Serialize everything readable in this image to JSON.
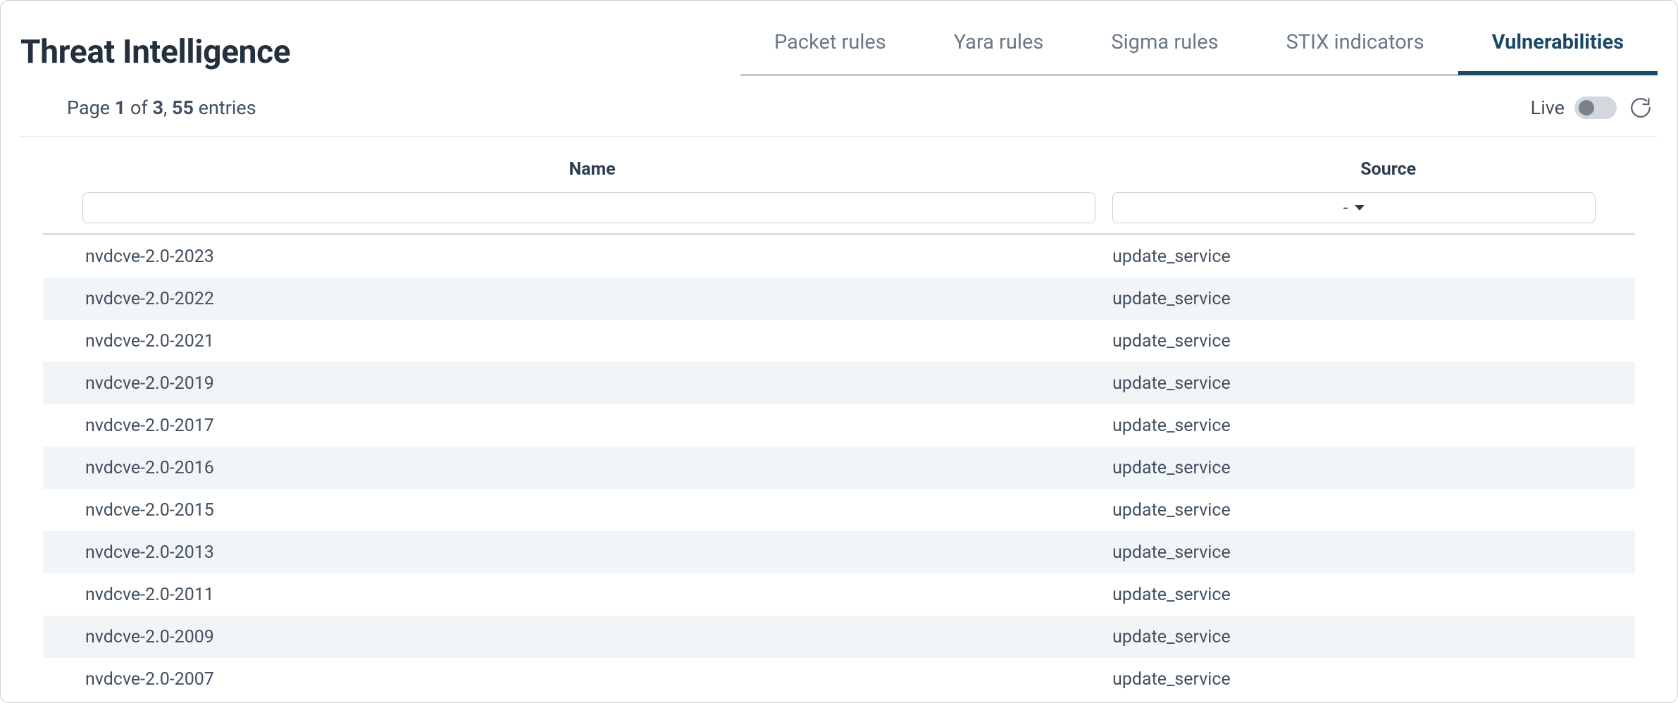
{
  "header": {
    "title": "Threat Intelligence"
  },
  "tabs": [
    {
      "label": "Packet rules",
      "active": false
    },
    {
      "label": "Yara rules",
      "active": false
    },
    {
      "label": "Sigma rules",
      "active": false
    },
    {
      "label": "STIX indicators",
      "active": false
    },
    {
      "label": "Vulnerabilities",
      "active": true
    }
  ],
  "pagination": {
    "prefix": "Page ",
    "current": "1",
    "of_word": " of ",
    "total_pages": "3",
    "comma": ", ",
    "total_entries": "55",
    "suffix": " entries"
  },
  "live": {
    "label": "Live",
    "enabled": false
  },
  "table": {
    "columns": {
      "name": "Name",
      "source": "Source"
    },
    "filters": {
      "name_value": "",
      "source_selected": "-"
    },
    "rows": [
      {
        "name": "nvdcve-2.0-2023",
        "source": "update_service"
      },
      {
        "name": "nvdcve-2.0-2022",
        "source": "update_service"
      },
      {
        "name": "nvdcve-2.0-2021",
        "source": "update_service"
      },
      {
        "name": "nvdcve-2.0-2019",
        "source": "update_service"
      },
      {
        "name": "nvdcve-2.0-2017",
        "source": "update_service"
      },
      {
        "name": "nvdcve-2.0-2016",
        "source": "update_service"
      },
      {
        "name": "nvdcve-2.0-2015",
        "source": "update_service"
      },
      {
        "name": "nvdcve-2.0-2013",
        "source": "update_service"
      },
      {
        "name": "nvdcve-2.0-2011",
        "source": "update_service"
      },
      {
        "name": "nvdcve-2.0-2009",
        "source": "update_service"
      },
      {
        "name": "nvdcve-2.0-2007",
        "source": "update_service"
      }
    ]
  }
}
